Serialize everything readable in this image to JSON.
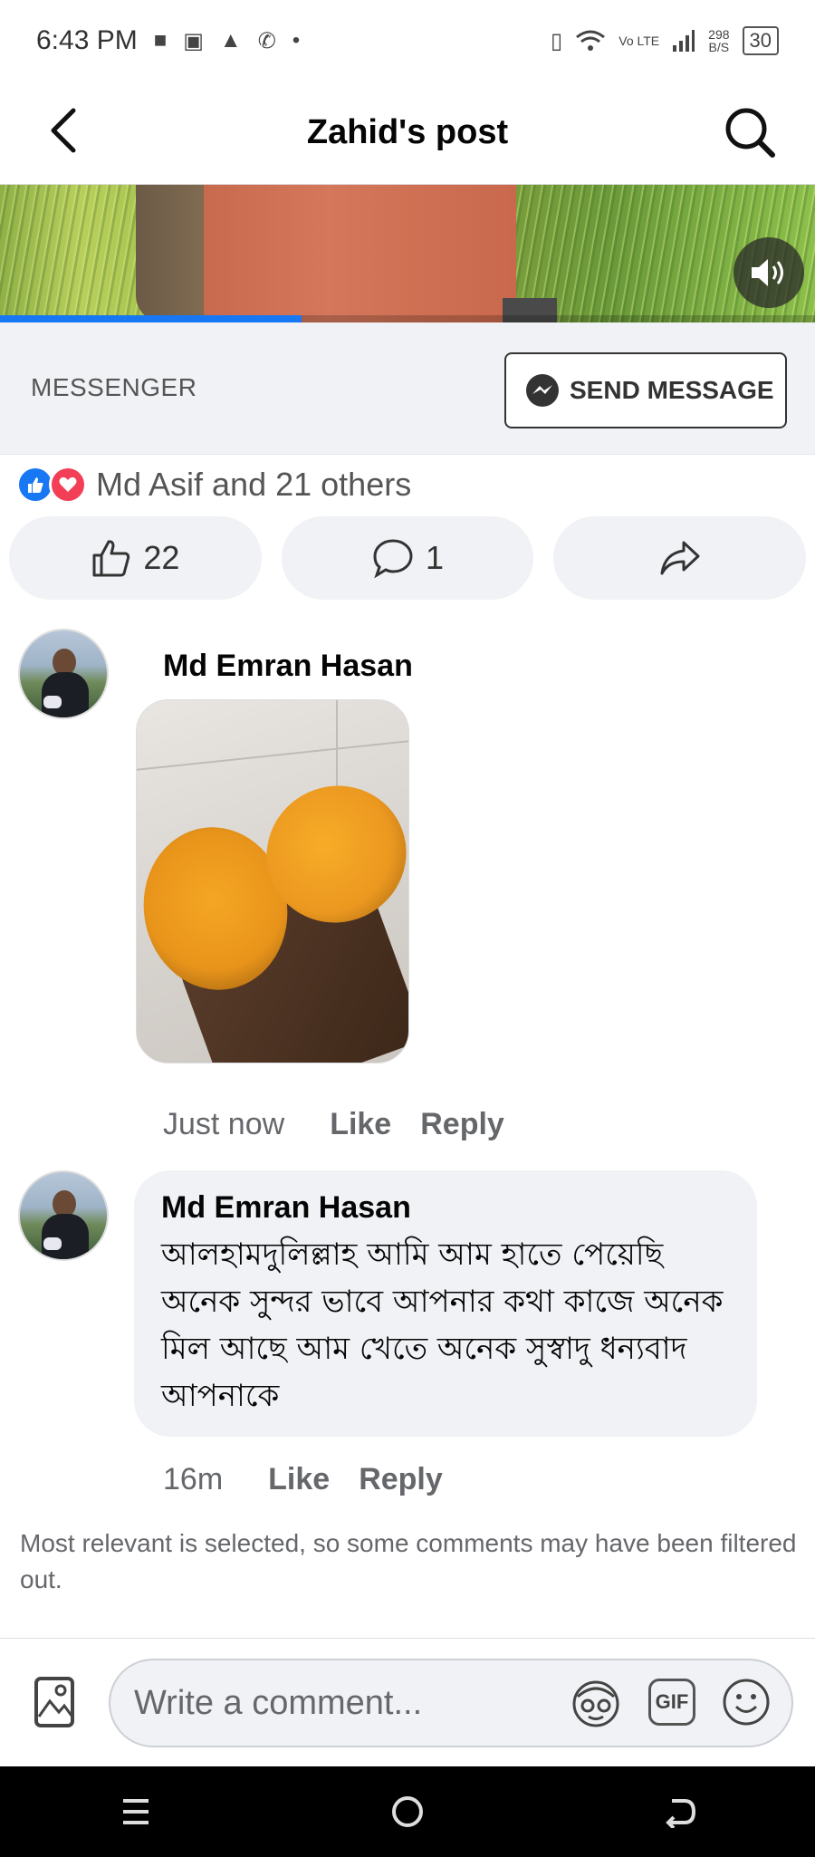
{
  "status_bar": {
    "time": "6:43 PM",
    "net_speed_value": "298",
    "net_speed_unit": "B/S",
    "lte_label": "Vo LTE",
    "battery": "30"
  },
  "header": {
    "title": "Zahid's post"
  },
  "video": {
    "progress": 0.37
  },
  "messenger": {
    "label": "MESSENGER",
    "send_button": "SEND MESSAGE"
  },
  "reactions": {
    "summary": "Md Asif and 21 others"
  },
  "actions": {
    "like_count": "22",
    "comment_count": "1"
  },
  "comments": [
    {
      "author": "Md Emran Hasan",
      "time": "Just now",
      "like_label": "Like",
      "reply_label": "Reply"
    },
    {
      "author": "Md Emran Hasan",
      "text": "আলহামদুলিল্লাহ আমি আম হাতে পেয়েছি অনেক সুন্দর  ভাবে আপনার কথা কাজে অনেক মিল আছে আম খেতে অনেক সুস্বাদু ধন্যবাদ আপনাকে",
      "time": "16m",
      "like_label": "Like",
      "reply_label": "Reply"
    }
  ],
  "filter_note": "Most relevant is selected, so some comments may have been filtered out.",
  "composer": {
    "placeholder": "Write a comment...",
    "gif_label": "GIF"
  },
  "colors": {
    "accent": "#1877f2",
    "love": "#f33e58",
    "bubble": "#f0f2f5",
    "secondary_text": "#65676b"
  }
}
